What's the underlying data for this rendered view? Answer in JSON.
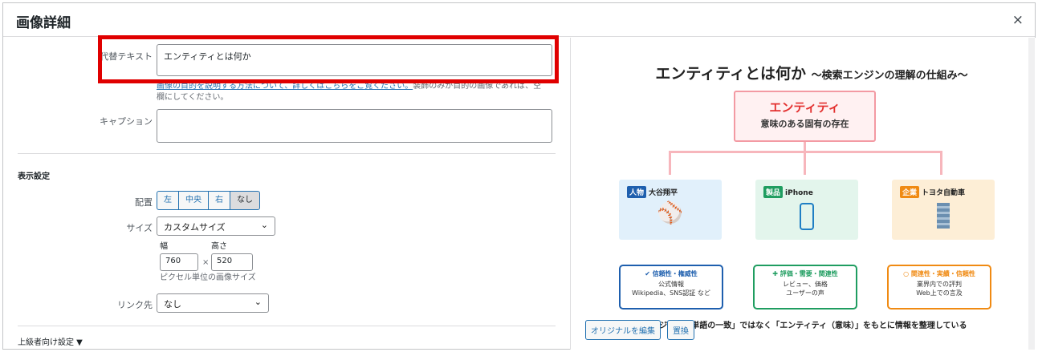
{
  "modal": {
    "title": "画像詳細",
    "close": "×"
  },
  "form": {
    "alt_label": "代替テキスト",
    "alt_value": "エンティティとは何か",
    "help_link": "画像の目的を説明する方法について、詳しくはこちらをご覧ください。",
    "help_tail": "装飾のみが目的の画像であれば、空",
    "help_line2": "欄にしてください。",
    "caption_label": "キャプション",
    "display_heading": "表示設定",
    "align_label": "配置",
    "align_options": [
      "左",
      "中央",
      "右",
      "なし"
    ],
    "align_selected": "なし",
    "size_label": "サイズ",
    "size_value": "カスタムサイズ",
    "width_label": "幅",
    "height_label": "高さ",
    "width_value": "760",
    "height_value": "520",
    "times": "×",
    "unit_text": "ピクセル単位の画像サイズ",
    "link_label": "リンク先",
    "link_value": "なし",
    "advanced": "上級者向け設定 ▼"
  },
  "preview": {
    "title_main": "エンティティとは何か",
    "title_sub": "～検索エンジンの理解の仕組み～",
    "top_a": "エンティティ",
    "top_b": "意味のある固有の存在",
    "cols": [
      {
        "tag": "人物",
        "name": "大谷翔平",
        "head": "信頼性・権威性",
        "l1": "公式情報",
        "l2": "Wikipedia、SNS認証 など",
        "color": "#1e5fae"
      },
      {
        "tag": "製品",
        "name": "iPhone",
        "head": "評価・需要・関連性",
        "l1": "レビュー、価格",
        "l2": "ユーザーの声",
        "color": "#1f9d60"
      },
      {
        "tag": "企業",
        "name": "トヨタ自動車",
        "head": "関連性・実績・信頼性",
        "l1": "業界内での評判",
        "l2": "Web上での言及",
        "color": "#f08a12"
      }
    ],
    "footnote": "検索エンジンは「単語の一致」ではなく「エンティティ（意味）」をもとに情報を整理している",
    "edit_button": "オリジナルを編集",
    "replace_button": "置換"
  }
}
